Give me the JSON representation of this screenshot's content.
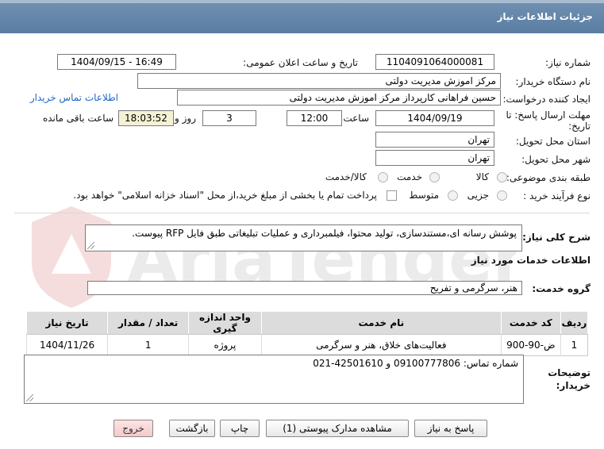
{
  "header": {
    "title": "جزئیات اطلاعات نیاز"
  },
  "form": {
    "need_number_label": "شماره نیاز:",
    "need_number": "1104091064000081",
    "announce_label": "تاریخ و ساعت اعلان عمومی:",
    "announce_value": "1404/09/15 - 16:49",
    "buyer_org_label": "نام دستگاه خریدار:",
    "buyer_org": "مرکز اموزش مدیریت دولتی",
    "creator_label": "ایجاد کننده درخواست:",
    "creator": "حسین  فراهانی کارپرداز مرکز اموزش مدیریت دولتی",
    "contact_link": "اطلاعات تماس خریدار",
    "deadline_label_1": "مهلت ارسال پاسخ: تا",
    "deadline_label_2": "تاریخ:",
    "deadline_date": "1404/09/19",
    "time_label": "ساعت",
    "deadline_time": "12:00",
    "days": "3",
    "days_label": "روز و",
    "remaining_time": "18:03:52",
    "remaining_label": "ساعت باقی مانده",
    "province_label": "استان محل تحویل:",
    "province": "تهران",
    "city_label": "شهر محل تحویل:",
    "city": "تهران",
    "category_label": "طبقه بندی موضوعی:",
    "category_options": [
      "کالا",
      "خدمت",
      "کالا/خدمت"
    ],
    "purchase_type_label": "نوع فرآیند خرید :",
    "purchase_options": [
      "جزیی",
      "متوسط"
    ],
    "purchase_note": "پرداخت تمام یا بخشی از مبلغ خرید،از محل \"اسناد خزانه اسلامی\" خواهد بود."
  },
  "description": {
    "label": "شرح کلی نیاز:",
    "text": "پوشش رسانه ای،مستندسازی، تولید محتوا، فیلمبرداری و عملیات تبلیغاتی طبق فایل RFP پیوست."
  },
  "services": {
    "section_title": "اطلاعات خدمات مورد نیاز",
    "group_label": "گروه خدمت:",
    "group_value": "هنر، سرگرمی و تفریح",
    "columns": [
      "ردیف",
      "کد خدمت",
      "نام خدمت",
      "واحد اندازه گیری",
      "تعداد / مقدار",
      "تاریخ نیاز"
    ],
    "rows": [
      [
        "1",
        "ض-90-900",
        "فعالیت‌های خلاق، هنر و سرگرمی",
        "پروژه",
        "1",
        "1404/11/26"
      ]
    ]
  },
  "buyer_notes": {
    "label_1": "توضیحات",
    "label_2": "خریدار:",
    "text": "شماره تماس: 09100777806 و 42501610-021"
  },
  "buttons": {
    "reply": "پاسخ به نیاز",
    "attachments": "مشاهده مدارک پیوستی (1)",
    "print": "چاپ",
    "back": "بازگشت",
    "exit": "خروج"
  },
  "watermark": {
    "text": "AriaTender.net"
  },
  "colors": {
    "header": "#5a7da3",
    "link": "#2166c9",
    "yellow_field": "#f5f1d4",
    "exit_button": "#f6c9c9"
  }
}
